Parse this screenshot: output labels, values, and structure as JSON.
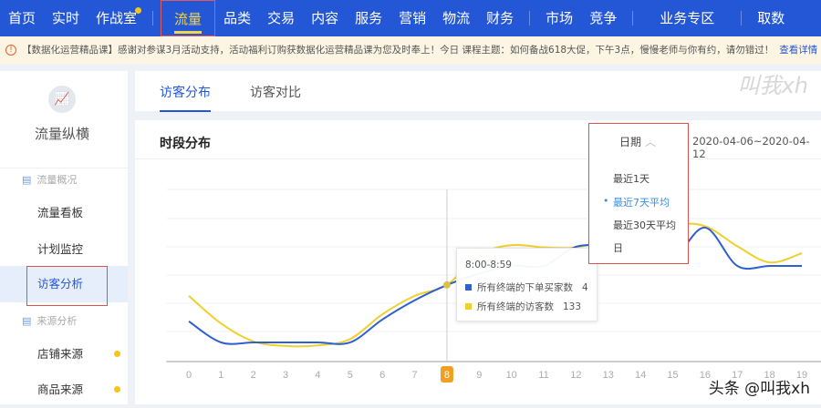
{
  "topnav": {
    "items": [
      "首页",
      "实时",
      "作战室",
      "流量",
      "品类",
      "交易",
      "内容",
      "服务",
      "营销",
      "物流",
      "财务",
      "市场",
      "竞争",
      "业务专区",
      "取数"
    ],
    "active": "流量"
  },
  "notice": {
    "text": "【数据化运营精品课】感谢对参谋3月活动支持，活动福利订购获数据化运营精品课为您及时奉上！今日 课程主题：如何备战618大促，下午3点，慢慢老师与你有约，请勿错过！",
    "link": "查看详情"
  },
  "sidebar": {
    "title": "流量纵横",
    "group1": "流量概况",
    "items1": [
      "流量看板",
      "计划监控",
      "访客分析"
    ],
    "group2": "来源分析",
    "items2": [
      "店铺来源",
      "商品来源"
    ],
    "active": "访客分析"
  },
  "tabs": [
    "访客分布",
    "访客对比"
  ],
  "panel": {
    "title": "时段分布",
    "date_label": "日期",
    "date_range": "2020-04-06~2020-04-12",
    "dropdown_options": [
      "最近1天",
      "最近7天平均",
      "最近30天平均",
      "日"
    ],
    "selected_option": "最近7天平均"
  },
  "tooltip": {
    "time": "8:00-8:59",
    "rows": [
      {
        "label": "所有终端的下单买家数",
        "value": "4"
      },
      {
        "label": "所有终端的访客数",
        "value": "133"
      }
    ]
  },
  "watermarks": {
    "top": "叫我xh",
    "bottom": "头条 @叫我xh"
  },
  "colors": {
    "nav": "#2457d6",
    "buyers": "#2f5fd0",
    "visitors": "#f0cf2e",
    "highlight": "#f0a020"
  },
  "chart_data": {
    "type": "line",
    "title": "时段分布",
    "x": [
      0,
      1,
      2,
      3,
      4,
      5,
      6,
      7,
      8,
      9,
      10,
      11,
      12,
      13,
      14,
      15,
      16,
      17,
      18,
      19
    ],
    "x_labels": [
      "0",
      "1",
      "2",
      "3",
      "4",
      "5",
      "6",
      "7",
      "8",
      "9",
      "10",
      "11",
      "12",
      "13",
      "14",
      "15",
      "16",
      "17",
      "18",
      "19"
    ],
    "highlighted_x": 8,
    "series": [
      {
        "name": "所有终端的下单买家数",
        "color": "#2f5fd0",
        "values": [
          2.1,
          1.0,
          1.0,
          1.0,
          1.0,
          1.0,
          2.2,
          3.2,
          4,
          4.6,
          5.0,
          5.0,
          6.0,
          6.0,
          5.7,
          5.4,
          7.0,
          5.0,
          5.0,
          5.0
        ]
      },
      {
        "name": "所有终端的访客数",
        "color": "#f0cf2e",
        "values": [
          114,
          66,
          35,
          27,
          28,
          39,
          82,
          114,
          133,
          185,
          202,
          198,
          198,
          213,
          229,
          238,
          235,
          200,
          172,
          188
        ]
      }
    ],
    "grid": true,
    "legend": "none"
  }
}
